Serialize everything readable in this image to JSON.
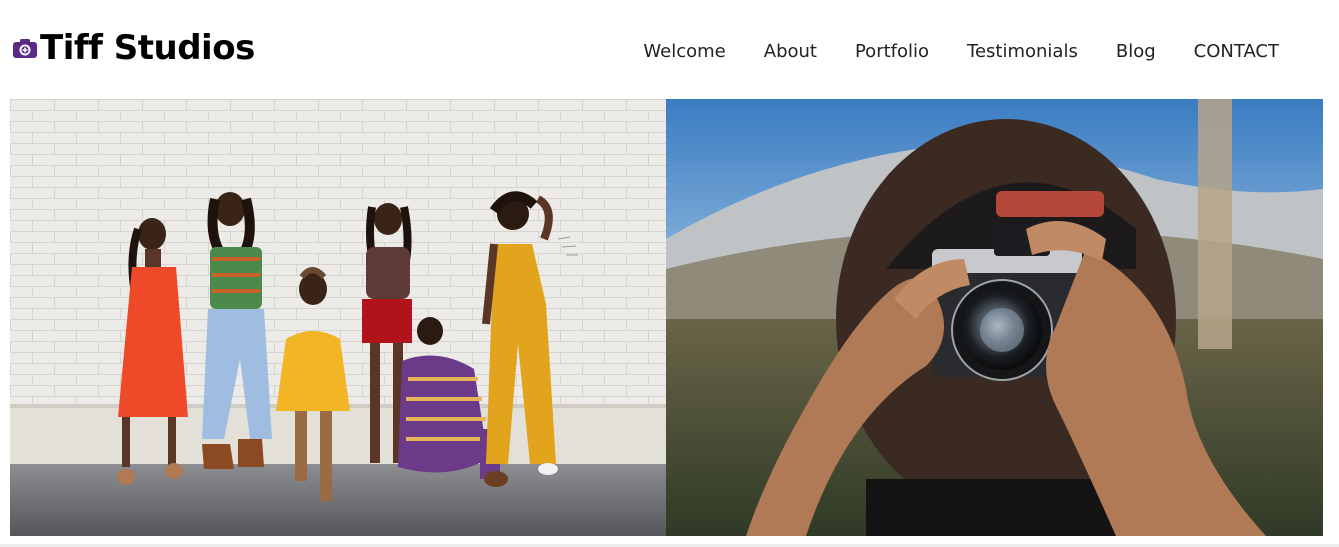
{
  "brand": {
    "name": "Tiff Studios",
    "icon": "camera-icon",
    "icon_color": "#5b2a86"
  },
  "nav": {
    "items": [
      {
        "label": "Welcome"
      },
      {
        "label": "About"
      },
      {
        "label": "Portfolio"
      },
      {
        "label": "Testimonials"
      },
      {
        "label": "Blog"
      },
      {
        "label": "CONTACT"
      }
    ]
  },
  "hero": {
    "left_image": "group-of-women-against-brick-wall-photo",
    "right_image": "person-holding-camera-photo"
  }
}
